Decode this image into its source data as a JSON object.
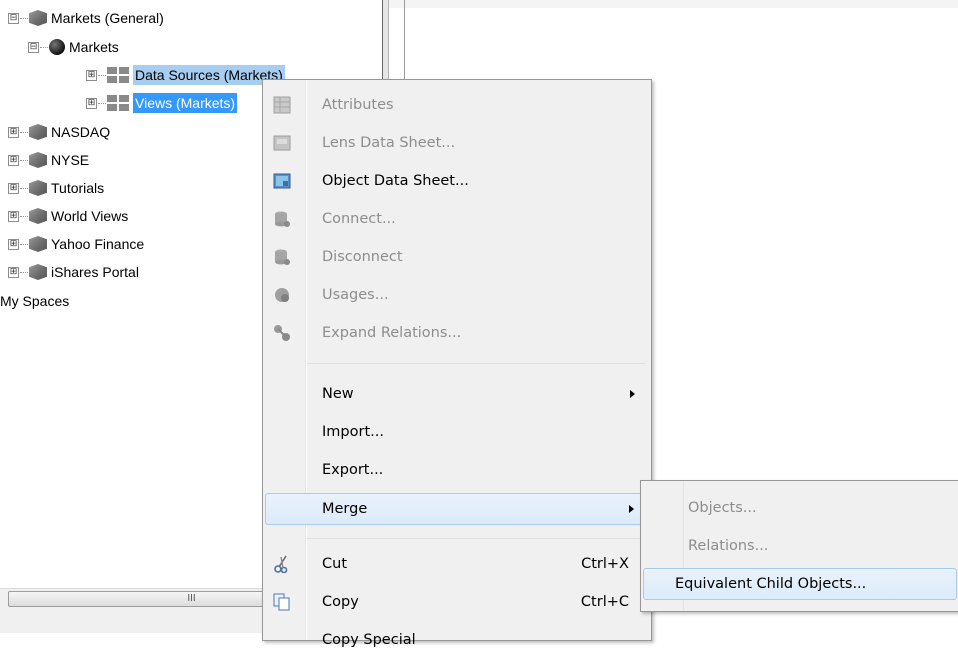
{
  "tree": {
    "items": [
      {
        "label": "Markets (General)",
        "expander": "⊟"
      },
      {
        "label": "Markets",
        "expander": "⊟"
      },
      {
        "label": "Data Sources (Markets)",
        "expander": "⊞"
      },
      {
        "label": "Views (Markets)",
        "expander": "⊞"
      },
      {
        "label": "NASDAQ",
        "expander": "⊞"
      },
      {
        "label": "NYSE",
        "expander": "⊞"
      },
      {
        "label": "Tutorials",
        "expander": "⊞"
      },
      {
        "label": "World Views",
        "expander": "⊞"
      },
      {
        "label": "Yahoo Finance",
        "expander": "⊞"
      },
      {
        "label": "iShares Portal",
        "expander": "⊞"
      },
      {
        "label": "My Spaces"
      }
    ],
    "scroll_grip": "III"
  },
  "context_menu": {
    "items": [
      {
        "label": "Attributes",
        "enabled": false,
        "icon": "table-icon"
      },
      {
        "label": "Lens Data Sheet...",
        "enabled": false,
        "icon": "lens-sheet-icon"
      },
      {
        "label": "Object Data Sheet...",
        "enabled": true,
        "icon": "object-sheet-icon"
      },
      {
        "label": "Connect...",
        "enabled": false,
        "icon": "database-connect-icon"
      },
      {
        "label": "Disconnect",
        "enabled": false,
        "icon": "database-disconnect-icon"
      },
      {
        "label": "Usages...",
        "enabled": false,
        "icon": "usages-icon"
      },
      {
        "label": "Expand Relations...",
        "enabled": false,
        "icon": "relations-icon"
      },
      {
        "label": "New",
        "enabled": true,
        "submenu": true
      },
      {
        "label": "Import...",
        "enabled": true
      },
      {
        "label": "Export...",
        "enabled": true
      },
      {
        "label": "Merge",
        "enabled": true,
        "submenu": true,
        "highlighted": true
      },
      {
        "label": "Cut",
        "shortcut": "Ctrl+X",
        "enabled": true,
        "icon": "scissors-icon"
      },
      {
        "label": "Copy",
        "shortcut": "Ctrl+C",
        "enabled": true,
        "icon": "copy-icon"
      },
      {
        "label": "Copy Special",
        "enabled": true
      }
    ]
  },
  "merge_submenu": {
    "items": [
      {
        "label": "Objects...",
        "enabled": false
      },
      {
        "label": "Relations...",
        "enabled": false
      },
      {
        "label": "Equivalent Child Objects...",
        "enabled": true,
        "highlighted": true
      }
    ]
  },
  "colors": {
    "selection": "#3399ff",
    "menu_background": "#f0f0f0",
    "disabled_text": "#8d8d8d",
    "hover_border": "#a8cbee"
  }
}
